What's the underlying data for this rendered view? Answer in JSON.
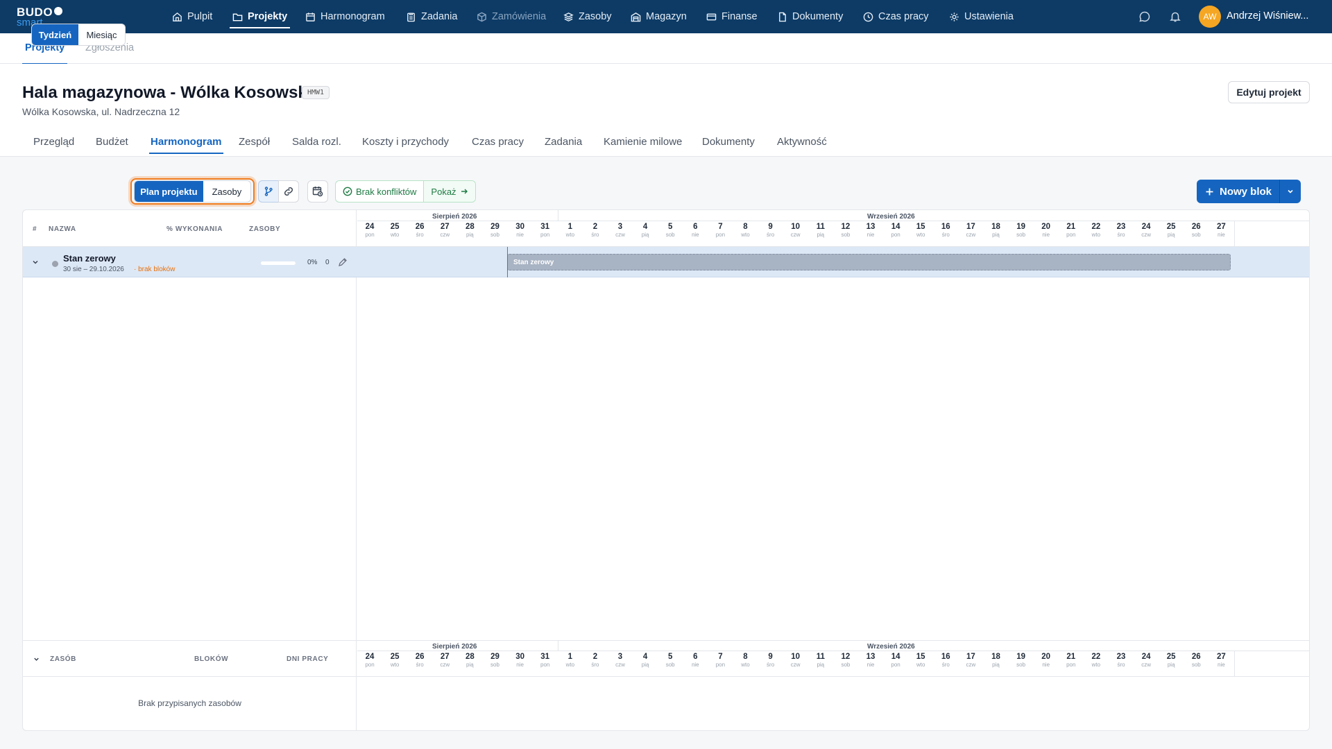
{
  "brand": {
    "line1": "BUDO",
    "line2": "smart"
  },
  "topnav": {
    "items": [
      {
        "label": "Pulpit",
        "icon": "home-icon"
      },
      {
        "label": "Projekty",
        "icon": "folder-icon"
      },
      {
        "label": "Harmonogram",
        "icon": "calendar-icon"
      },
      {
        "label": "Zadania",
        "icon": "clipboard-icon"
      },
      {
        "label": "Zamówienia",
        "icon": "package-icon"
      },
      {
        "label": "Zasoby",
        "icon": "layers-icon"
      },
      {
        "label": "Magazyn",
        "icon": "warehouse-icon"
      },
      {
        "label": "Finanse",
        "icon": "credit-card-icon"
      },
      {
        "label": "Dokumenty",
        "icon": "documents-icon"
      },
      {
        "label": "Czas pracy",
        "icon": "clock-icon"
      },
      {
        "label": "Ustawienia",
        "icon": "gear-icon"
      }
    ],
    "active": "Projekty",
    "disabled": "Zamówienia",
    "user": {
      "initials": "AW",
      "name": "Andrzej Wiśniew..."
    }
  },
  "subnav": {
    "tabs": [
      "Projekty",
      "Zgłoszenia"
    ],
    "active": "Projekty"
  },
  "project": {
    "title": "Hala magazynowa - Wólka Kosowska",
    "code": "HMW1",
    "address": "Wólka Kosowska, ul. Nadrzeczna 12",
    "edit_label": "Edytuj projekt",
    "tabs": [
      "Przegląd",
      "Budżet",
      "Harmonogram",
      "Zespół",
      "Salda rozl.",
      "Koszty i przychody",
      "Czas pracy",
      "Zadania",
      "Kamienie milowe",
      "Dokumenty",
      "Aktywność"
    ],
    "active_tab": "Harmonogram"
  },
  "toolbar": {
    "range": {
      "week": "Tydzień",
      "month": "Miesiąc",
      "selected": "Tydzień"
    },
    "view": {
      "plan": "Plan projektu",
      "resources": "Zasoby",
      "selected": "Plan projektu"
    },
    "conflicts": {
      "label": "Brak konfliktów",
      "show": "Pokaż"
    },
    "new_block": "Nowy blok",
    "icons": [
      "branch-icon",
      "link-icon",
      "calendar-clock-icon"
    ]
  },
  "grid": {
    "columns": {
      "num": "#",
      "name": "NAZWA",
      "progress": "% WYKONANIA",
      "resources": "ZASOBY"
    },
    "months": [
      "Sierpień 2026",
      "Wrzesień 2026"
    ],
    "days": [
      {
        "d": "24",
        "w": "pon"
      },
      {
        "d": "25",
        "w": "wto"
      },
      {
        "d": "26",
        "w": "śro"
      },
      {
        "d": "27",
        "w": "czw"
      },
      {
        "d": "28",
        "w": "pią"
      },
      {
        "d": "29",
        "w": "sob"
      },
      {
        "d": "30",
        "w": "nie"
      },
      {
        "d": "31",
        "w": "pon"
      },
      {
        "d": "1",
        "w": "wto"
      },
      {
        "d": "2",
        "w": "śro"
      },
      {
        "d": "3",
        "w": "czw"
      },
      {
        "d": "4",
        "w": "pią"
      },
      {
        "d": "5",
        "w": "sob"
      },
      {
        "d": "6",
        "w": "nie"
      },
      {
        "d": "7",
        "w": "pon"
      },
      {
        "d": "8",
        "w": "wto"
      },
      {
        "d": "9",
        "w": "śro"
      },
      {
        "d": "10",
        "w": "czw"
      },
      {
        "d": "11",
        "w": "pią"
      },
      {
        "d": "12",
        "w": "sob"
      },
      {
        "d": "13",
        "w": "nie"
      },
      {
        "d": "14",
        "w": "pon"
      },
      {
        "d": "15",
        "w": "wto"
      },
      {
        "d": "16",
        "w": "śro"
      },
      {
        "d": "17",
        "w": "czw"
      },
      {
        "d": "18",
        "w": "pią"
      },
      {
        "d": "19",
        "w": "sob"
      },
      {
        "d": "20",
        "w": "nie"
      },
      {
        "d": "21",
        "w": "pon"
      },
      {
        "d": "22",
        "w": "wto"
      },
      {
        "d": "23",
        "w": "śro"
      },
      {
        "d": "24",
        "w": "czw"
      },
      {
        "d": "25",
        "w": "pią"
      },
      {
        "d": "26",
        "w": "sob"
      },
      {
        "d": "27",
        "w": "nie"
      }
    ],
    "rows": [
      {
        "name": "Stan zerowy",
        "dates": "30 sie – 29.10.2026",
        "warning": "· brak bloków",
        "progress": "0%",
        "progress_value": 0,
        "resources": "0",
        "bar_label": "Stan zerowy"
      }
    ]
  },
  "resources": {
    "columns": {
      "resource": "ZASÓB",
      "blocks": "BLOKÓW",
      "days": "DNI PRACY"
    },
    "empty": "Brak przypisanych zasobów"
  },
  "colors": {
    "navy": "#0d3b66",
    "primary": "#1565c0",
    "focus": "#f07b1e",
    "success": "#1e7a44",
    "warning": "#e8700a",
    "avatar": "#f5a623"
  }
}
